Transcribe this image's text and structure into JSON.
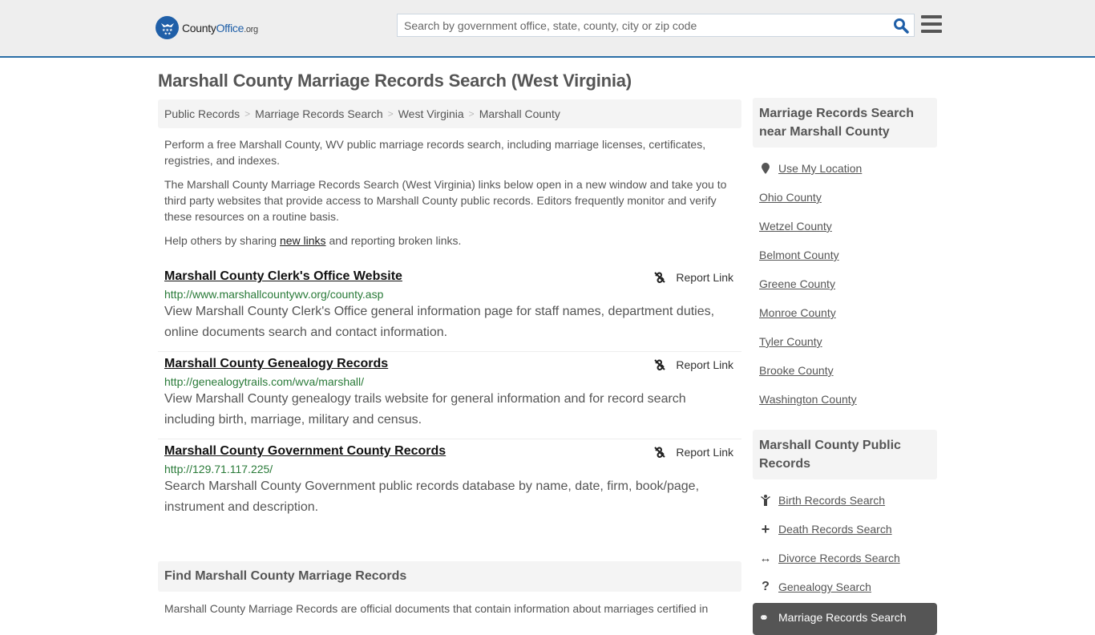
{
  "header": {
    "logo": {
      "county": "County",
      "office": "Office",
      "org": ".org"
    },
    "search_placeholder": "Search by government office, state, county, city or zip code",
    "search_icon": "search-icon",
    "menu_icon": "hamburger-menu-icon"
  },
  "page_title": "Marshall County Marriage Records Search (West Virginia)",
  "breadcrumb": [
    "Public Records",
    "Marriage Records Search",
    "West Virginia",
    "Marshall County"
  ],
  "intro": {
    "p1": "Perform a free Marshall County, WV public marriage records search, including marriage licenses, certificates, registries, and indexes.",
    "p2": "The Marshall County Marriage Records Search (West Virginia) links below open in a new window and take you to third party websites that provide access to Marshall County public records. Editors frequently monitor and verify these resources on a routine basis.",
    "p3_before": "Help others by sharing ",
    "p3_link": "new links",
    "p3_after": " and reporting broken links."
  },
  "results": [
    {
      "title": "Marshall County Clerk's Office Website",
      "url": "http://www.marshallcountywv.org/county.asp",
      "description": "View Marshall County Clerk's Office general information page for staff names, department duties, online documents search and contact information.",
      "report_label": "Report Link"
    },
    {
      "title": "Marshall County Genealogy Records",
      "url": "http://genealogytrails.com/wva/marshall/",
      "description": "View Marshall County genealogy trails website for general information and for record search including birth, marriage, military and census.",
      "report_label": "Report Link"
    },
    {
      "title": "Marshall County Government County Records",
      "url": "http://129.71.117.225/",
      "description": "Search Marshall County Government public records database by name, date, firm, book/page, instrument and description.",
      "report_label": "Report Link"
    }
  ],
  "find": {
    "heading": "Find Marshall County Marriage Records",
    "text": "Marshall County Marriage Records are official documents that contain information about marriages certified in"
  },
  "sidebar": {
    "nearby_heading": "Marriage Records Search near Marshall County",
    "use_location": "Use My Location",
    "nearby": [
      "Ohio County",
      "Wetzel County",
      "Belmont County",
      "Greene County",
      "Monroe County",
      "Tyler County",
      "Brooke County",
      "Washington County"
    ],
    "public_heading": "Marshall County Public Records",
    "public_links": [
      {
        "label": "Birth Records Search",
        "icon": "child-icon",
        "glyph": "†"
      },
      {
        "label": "Death Records Search",
        "icon": "plus-icon",
        "glyph": "+"
      },
      {
        "label": "Divorce Records Search",
        "icon": "double-arrow-icon",
        "glyph": "↔"
      },
      {
        "label": "Genealogy Search",
        "icon": "question-icon",
        "glyph": "?"
      }
    ],
    "active": {
      "label": "Marriage Records Search",
      "icon": "rings-icon",
      "glyph": "⚭"
    }
  }
}
